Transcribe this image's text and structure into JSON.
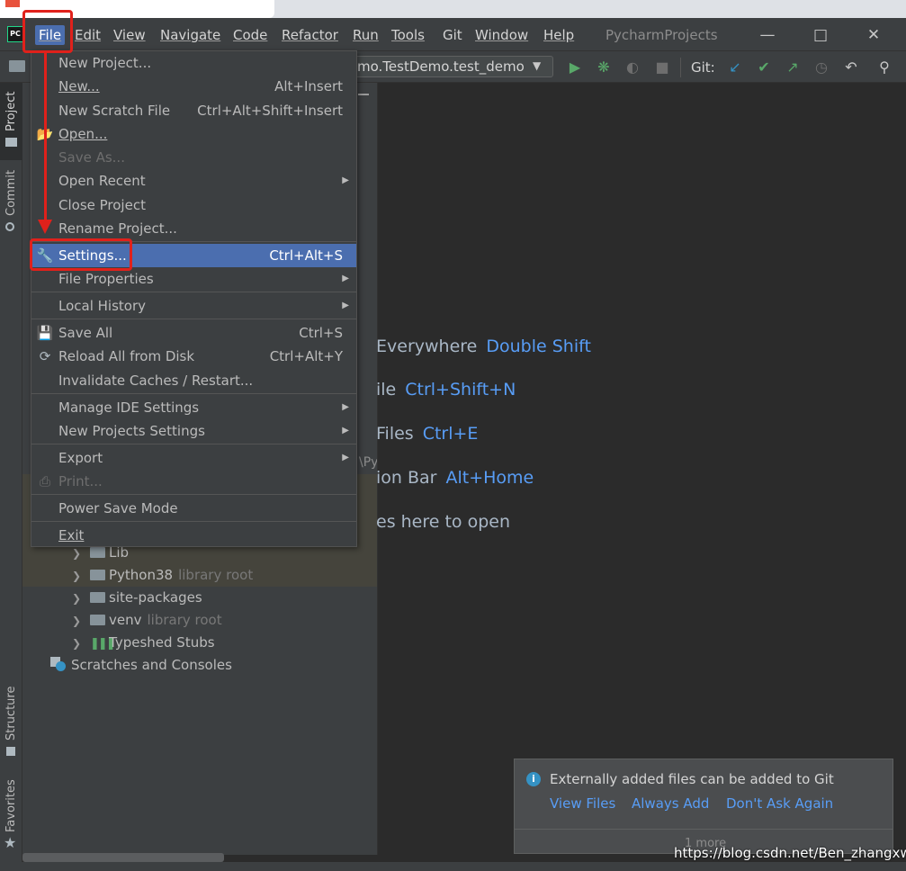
{
  "menubar": {
    "items": [
      "File",
      "Edit",
      "View",
      "Navigate",
      "Code",
      "Refactor",
      "Run",
      "Tools",
      "Git",
      "Window",
      "Help"
    ],
    "window_title": "PycharmProjects"
  },
  "toolbar": {
    "run_config": "mo.TestDemo.test_demo",
    "git_label": "Git:"
  },
  "left_strip": {
    "project": "Project",
    "commit": "Commit",
    "structure": "Structure",
    "favorites": "Favorites"
  },
  "file_menu": {
    "new_project": "New Project...",
    "new": "New...",
    "new_shortcut": "Alt+Insert",
    "new_scratch": "New Scratch File",
    "new_scratch_shortcut": "Ctrl+Alt+Shift+Insert",
    "open": "Open...",
    "save_as": "Save As...",
    "open_recent": "Open Recent",
    "close_project": "Close Project",
    "rename_project": "Rename Project...",
    "settings": "Settings...",
    "settings_shortcut": "Ctrl+Alt+S",
    "file_properties": "File Properties",
    "local_history": "Local History",
    "save_all": "Save All",
    "save_all_shortcut": "Ctrl+S",
    "reload": "Reload All from Disk",
    "reload_shortcut": "Ctrl+Alt+Y",
    "invalidate": "Invalidate Caches / Restart...",
    "manage_ide": "Manage IDE Settings",
    "new_projects_settings": "New Projects Settings",
    "export": "Export",
    "print": "Print...",
    "power_save": "Power Save Mode",
    "exit": "Exit"
  },
  "project_tree": {
    "path_fragment": "\\Py",
    "lib": "Lib",
    "python38": "Python38",
    "python38_tag": "library root",
    "site_packages": "site-packages",
    "venv": "venv",
    "venv_tag": "library root",
    "typeshed": "Typeshed Stubs",
    "scratches": "Scratches and Consoles"
  },
  "editor_hints": [
    {
      "text": "Everywhere",
      "key": "Double Shift"
    },
    {
      "text": "ile",
      "key": "Ctrl+Shift+N"
    },
    {
      "text": "Files",
      "key": "Ctrl+E"
    },
    {
      "text": "ion Bar",
      "key": "Alt+Home"
    },
    {
      "text": "es here to open",
      "key": ""
    }
  ],
  "notification": {
    "message": "Externally added files can be added to Git",
    "view_files": "View Files",
    "always_add": "Always Add",
    "dont_ask": "Don't Ask Again",
    "more": "1 more"
  },
  "watermark": "https://blog.csdn.net/Ben_zhangxw",
  "colors": {
    "accent": "#4b6eaf",
    "annotation": "#e0211b",
    "link": "#589df6"
  }
}
